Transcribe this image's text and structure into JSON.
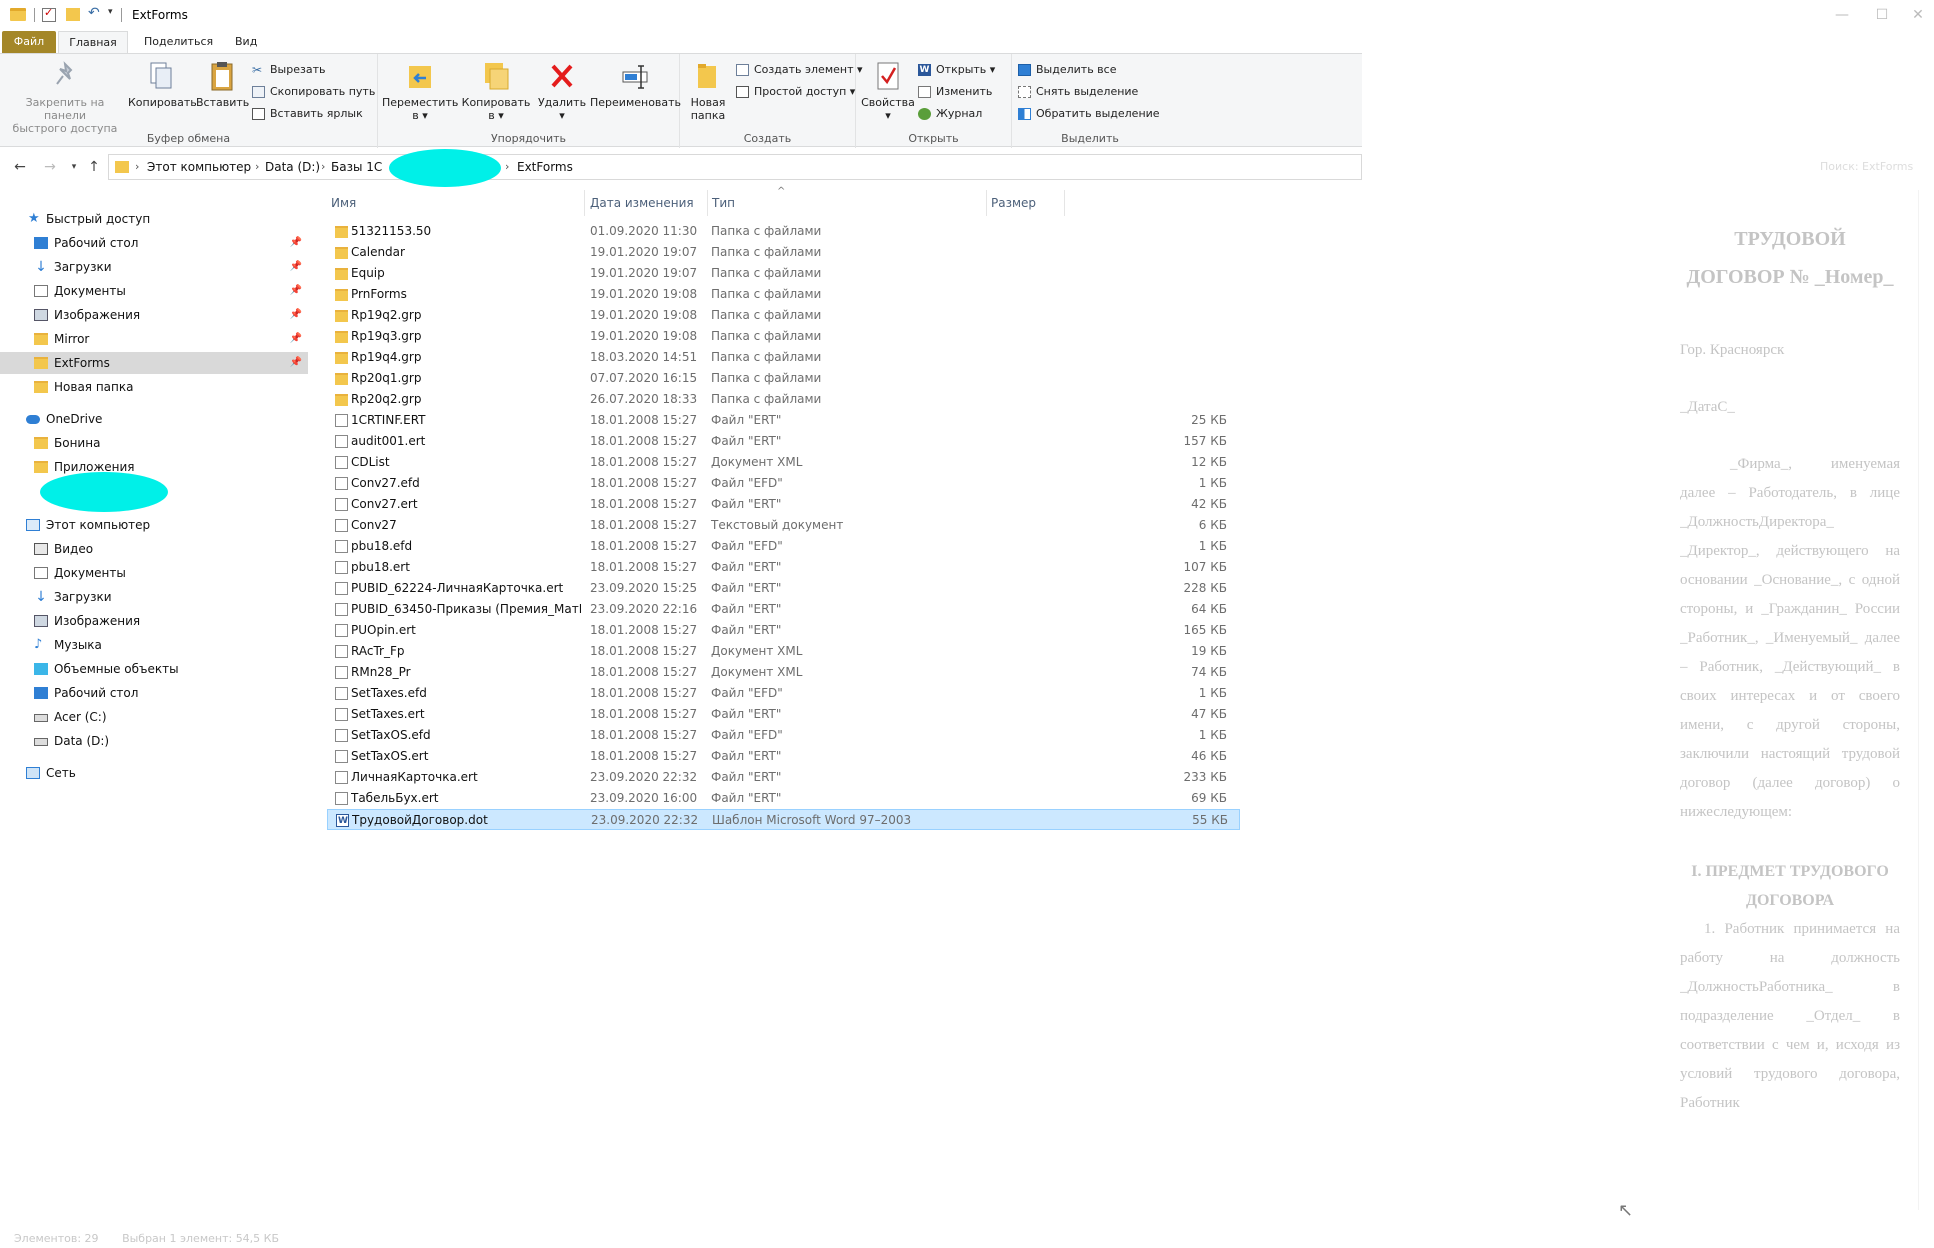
{
  "window": {
    "title": "ExtForms",
    "controls": [
      "—",
      "☐",
      "✕"
    ]
  },
  "ribbon": {
    "tabs": {
      "file": "Файл",
      "home": "Главная",
      "share": "Поделиться",
      "view": "Вид"
    },
    "clipboard": {
      "pin_line1": "Закрепить на панели",
      "pin_line2": "быстрого доступа",
      "copy": "Копировать",
      "paste": "Вставить",
      "cut": "Вырезать",
      "copy_path": "Скопировать путь",
      "paste_shortcut": "Вставить ярлык",
      "label": "Буфер обмена"
    },
    "organize": {
      "move_line1": "Переместить",
      "move_line2": "в ▾",
      "copyto_line1": "Копировать",
      "copyto_line2": "в ▾",
      "delete_line1": "Удалить",
      "delete_line2": "▾",
      "rename": "Переименовать",
      "label": "Упорядочить"
    },
    "new": {
      "folder_line1": "Новая",
      "folder_line2": "папка",
      "new_item": "Создать элемент ▾",
      "easy_access": "Простой доступ ▾",
      "label": "Создать"
    },
    "open": {
      "properties": "Свойства",
      "properties_dd": "▾",
      "open": "Открыть ▾",
      "edit": "Изменить",
      "history": "Журнал",
      "label": "Открыть"
    },
    "select": {
      "select_all": "Выделить все",
      "select_none": "Снять выделение",
      "invert": "Обратить выделение",
      "label": "Выделить"
    }
  },
  "address": {
    "crumbs": [
      "Этот компьютер",
      "Data (D:)",
      "Базы 1С",
      "ExtForms"
    ],
    "search_placeholder": "Поиск: ExtForms"
  },
  "navpane": {
    "quick_access": "Быстрый доступ",
    "quick_items": [
      "Рабочий стол",
      "Загрузки",
      "Документы",
      "Изображения",
      "Mirror",
      "ExtForms",
      "Новая папка"
    ],
    "onedrive": "OneDrive",
    "onedrive_items": [
      "Бонина",
      "Приложения"
    ],
    "this_pc": "Этот компьютер",
    "pc_items": [
      "Видео",
      "Документы",
      "Загрузки",
      "Изображения",
      "Музыка",
      "Объемные объекты",
      "Рабочий стол",
      "Acer (C:)",
      "Data (D:)"
    ],
    "network": "Сеть"
  },
  "columns": {
    "name": "Имя",
    "date": "Дата изменения",
    "type": "Тип",
    "size": "Размер"
  },
  "files": [
    {
      "name": "51321153.50",
      "date": "01.09.2020 11:30",
      "type": "Папка с файлами",
      "size": "",
      "icon": "folder"
    },
    {
      "name": "Calendar",
      "date": "19.01.2020 19:07",
      "type": "Папка с файлами",
      "size": "",
      "icon": "folder"
    },
    {
      "name": "Equip",
      "date": "19.01.2020 19:07",
      "type": "Папка с файлами",
      "size": "",
      "icon": "folder"
    },
    {
      "name": "PrnForms",
      "date": "19.01.2020 19:08",
      "type": "Папка с файлами",
      "size": "",
      "icon": "folder"
    },
    {
      "name": "Rp19q2.grp",
      "date": "19.01.2020 19:08",
      "type": "Папка с файлами",
      "size": "",
      "icon": "folder"
    },
    {
      "name": "Rp19q3.grp",
      "date": "19.01.2020 19:08",
      "type": "Папка с файлами",
      "size": "",
      "icon": "folder"
    },
    {
      "name": "Rp19q4.grp",
      "date": "18.03.2020 14:51",
      "type": "Папка с файлами",
      "size": "",
      "icon": "folder"
    },
    {
      "name": "Rp20q1.grp",
      "date": "07.07.2020 16:15",
      "type": "Папка с файлами",
      "size": "",
      "icon": "folder"
    },
    {
      "name": "Rp20q2.grp",
      "date": "26.07.2020 18:33",
      "type": "Папка с файлами",
      "size": "",
      "icon": "folder"
    },
    {
      "name": "1CRTINF.ERT",
      "date": "18.01.2008 15:27",
      "type": "Файл \"ERT\"",
      "size": "25 КБ",
      "icon": "doc"
    },
    {
      "name": "audit001.ert",
      "date": "18.01.2008 15:27",
      "type": "Файл \"ERT\"",
      "size": "157 КБ",
      "icon": "doc"
    },
    {
      "name": "CDList",
      "date": "18.01.2008 15:27",
      "type": "Документ XML",
      "size": "12 КБ",
      "icon": "doc"
    },
    {
      "name": "Conv27.efd",
      "date": "18.01.2008 15:27",
      "type": "Файл \"EFD\"",
      "size": "1 КБ",
      "icon": "doc"
    },
    {
      "name": "Conv27.ert",
      "date": "18.01.2008 15:27",
      "type": "Файл \"ERT\"",
      "size": "42 КБ",
      "icon": "doc"
    },
    {
      "name": "Conv27",
      "date": "18.01.2008 15:27",
      "type": "Текстовый документ",
      "size": "6 КБ",
      "icon": "doc"
    },
    {
      "name": "pbu18.efd",
      "date": "18.01.2008 15:27",
      "type": "Файл \"EFD\"",
      "size": "1 КБ",
      "icon": "doc"
    },
    {
      "name": "pbu18.ert",
      "date": "18.01.2008 15:27",
      "type": "Файл \"ERT\"",
      "size": "107 КБ",
      "icon": "doc"
    },
    {
      "name": "PUBID_62224-ЛичнаяКарточка.ert",
      "date": "23.09.2020 15:25",
      "type": "Файл \"ERT\"",
      "size": "228 КБ",
      "icon": "doc"
    },
    {
      "name": "PUBID_63450-Приказы (Премия_МатПо...",
      "date": "23.09.2020 22:16",
      "type": "Файл \"ERT\"",
      "size": "64 КБ",
      "icon": "doc"
    },
    {
      "name": "PUOpin.ert",
      "date": "18.01.2008 15:27",
      "type": "Файл \"ERT\"",
      "size": "165 КБ",
      "icon": "doc"
    },
    {
      "name": "RAcTr_Fp",
      "date": "18.01.2008 15:27",
      "type": "Документ XML",
      "size": "19 КБ",
      "icon": "doc"
    },
    {
      "name": "RMn28_Pr",
      "date": "18.01.2008 15:27",
      "type": "Документ XML",
      "size": "74 КБ",
      "icon": "doc"
    },
    {
      "name": "SetTaxes.efd",
      "date": "18.01.2008 15:27",
      "type": "Файл \"EFD\"",
      "size": "1 КБ",
      "icon": "doc"
    },
    {
      "name": "SetTaxes.ert",
      "date": "18.01.2008 15:27",
      "type": "Файл \"ERT\"",
      "size": "47 КБ",
      "icon": "doc"
    },
    {
      "name": "SetTaxOS.efd",
      "date": "18.01.2008 15:27",
      "type": "Файл \"EFD\"",
      "size": "1 КБ",
      "icon": "doc"
    },
    {
      "name": "SetTaxOS.ert",
      "date": "18.01.2008 15:27",
      "type": "Файл \"ERT\"",
      "size": "46 КБ",
      "icon": "doc"
    },
    {
      "name": "ЛичнаяКарточка.ert",
      "date": "23.09.2020 22:32",
      "type": "Файл \"ERT\"",
      "size": "233 КБ",
      "icon": "doc"
    },
    {
      "name": "ТабельБух.ert",
      "date": "23.09.2020 16:00",
      "type": "Файл \"ERT\"",
      "size": "69 КБ",
      "icon": "doc"
    },
    {
      "name": "ТрудовойДоговор.dot",
      "date": "23.09.2020 22:32",
      "type": "Шаблон Microsoft Word 97–2003",
      "size": "55 КБ",
      "icon": "word",
      "selected": true
    }
  ],
  "status": {
    "count": "Элементов: 29",
    "selected": "Выбран 1 элемент: 54,5 КБ"
  },
  "preview": {
    "title_line1": "ТРУДОВОЙ",
    "title_line2": "ДОГОВОР № _Номер_",
    "city": "Гор. Красноярск",
    "date": "_ДатаС_",
    "body": "_Фирма_, именуемая далее – Работодатель, в лице _ДолжностьДиректора_ _Директор_, действующего на основании _Основание_, с одной стороны, и _Гражданин_ России _Работник_, _Именуемый_ далее – Работник, _Действующий_ в своих интересах и от своего имени, с другой стороны, заключили настоящий трудовой договор (далее договор) о нижеследующем:",
    "section": "I. ПРЕДМЕТ ТРУДОВОГО ДОГОВОРА",
    "p1": "1. Работник принимается на работу на должность _ДолжностьРаботника_ в подразделение _Отдел_ в соответствии с чем и, исходя из условий трудового договора, Работник"
  },
  "colors": {
    "accent_file_tab": "#a48728",
    "selection": "#cce8ff",
    "folder": "#f3c74d",
    "redaction": "#00f0e8"
  }
}
